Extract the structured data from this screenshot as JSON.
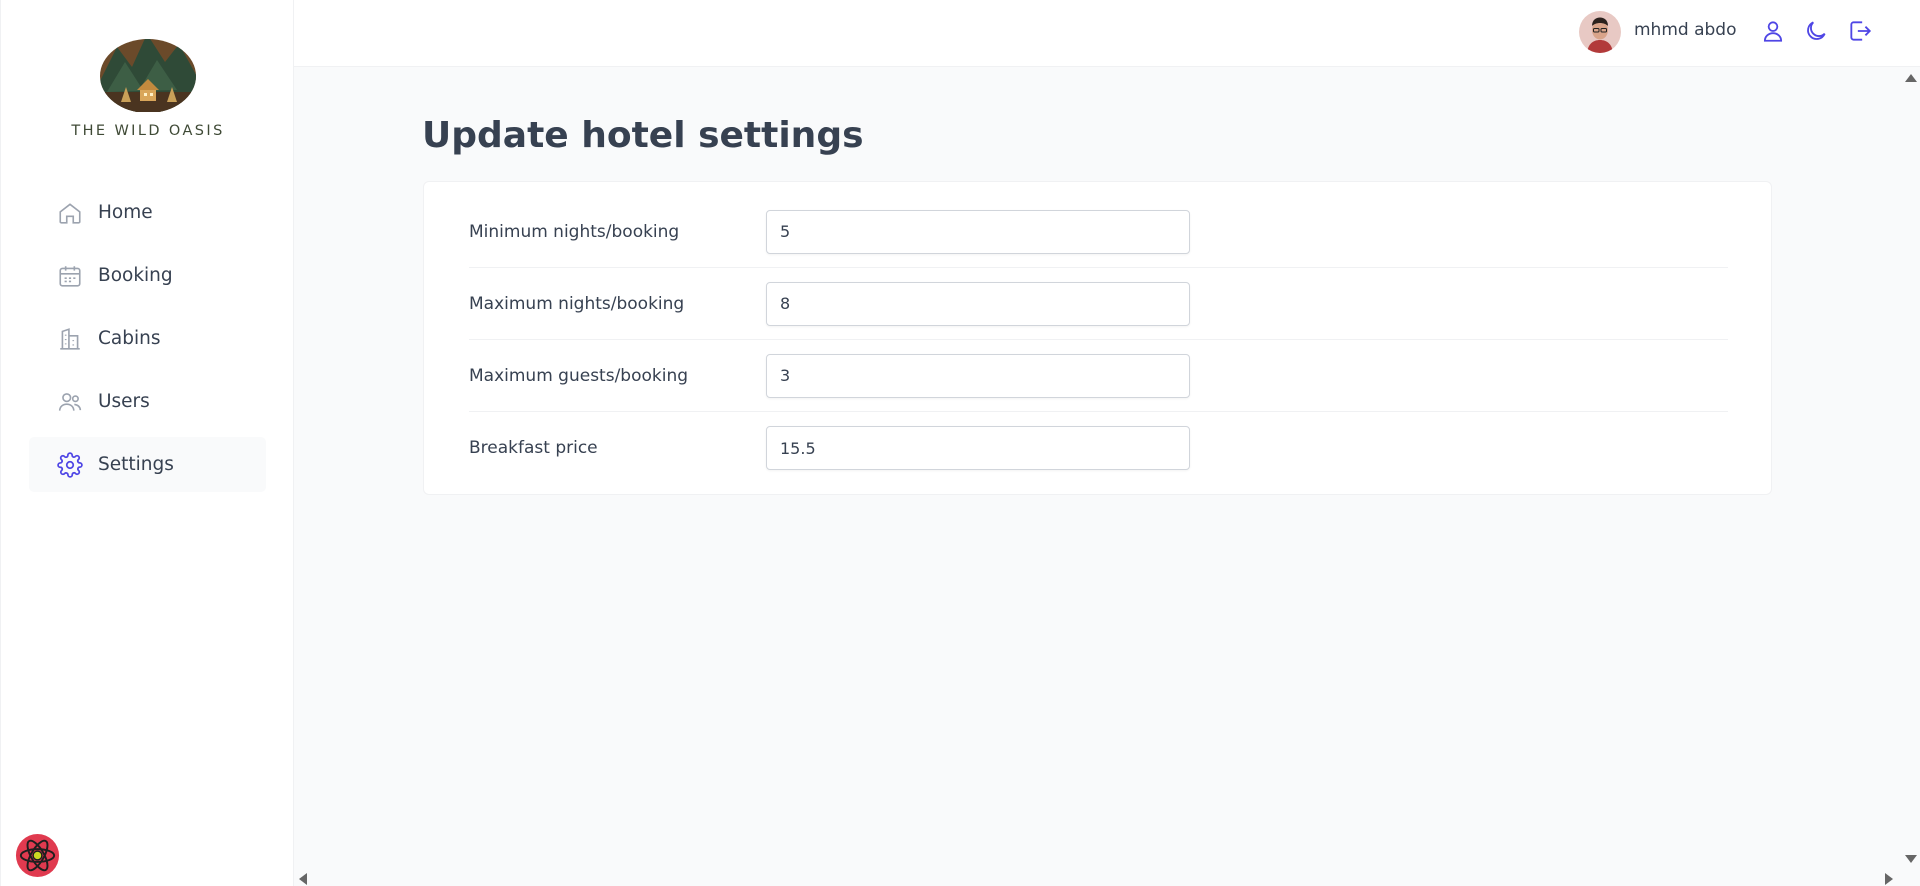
{
  "brand": {
    "name": "THE WILD OASIS"
  },
  "sidebar": {
    "items": [
      {
        "label": "Home",
        "icon": "home-icon"
      },
      {
        "label": "Booking",
        "icon": "calendar-icon"
      },
      {
        "label": "Cabins",
        "icon": "building-icon"
      },
      {
        "label": "Users",
        "icon": "users-icon"
      },
      {
        "label": "Settings",
        "icon": "gear-icon",
        "active": true
      }
    ]
  },
  "header": {
    "user_name": "mhmd abdo",
    "icons": [
      "user-icon",
      "moon-icon",
      "logout-icon"
    ],
    "accent_color": "#4f46e5"
  },
  "main": {
    "title": "Update hotel settings",
    "fields": [
      {
        "label": "Minimum nights/booking",
        "value": "5"
      },
      {
        "label": "Maximum nights/booking",
        "value": "8"
      },
      {
        "label": "Maximum guests/booking",
        "value": "3"
      },
      {
        "label": "Breakfast price",
        "value": "15.5"
      }
    ]
  }
}
